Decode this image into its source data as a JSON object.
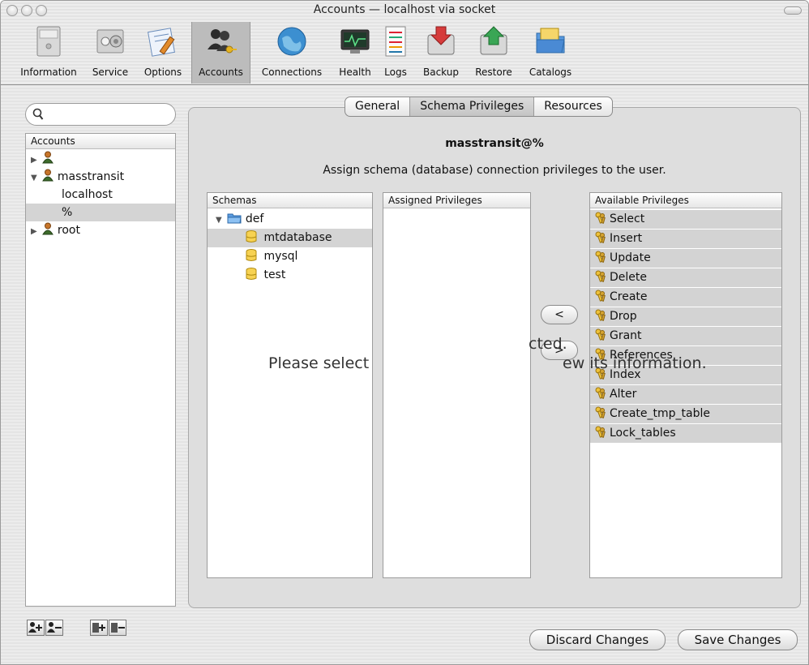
{
  "window": {
    "title": "Accounts — localhost via socket"
  },
  "toolbar": {
    "items": [
      {
        "label": "Information",
        "icon": "server-tower-icon"
      },
      {
        "label": "Service",
        "icon": "control-panel-icon"
      },
      {
        "label": "Options",
        "icon": "options-pen-icon"
      },
      {
        "label": "Accounts",
        "icon": "users-key-icon",
        "active": true
      },
      {
        "label": "Connections",
        "icon": "globe-icon"
      },
      {
        "label": "Health",
        "icon": "monitor-icon"
      },
      {
        "label": "Logs",
        "icon": "list-icon"
      },
      {
        "label": "Backup",
        "icon": "disk-down-arrow-icon"
      },
      {
        "label": "Restore",
        "icon": "disk-up-arrow-icon"
      },
      {
        "label": "Catalogs",
        "icon": "folder-icon"
      }
    ]
  },
  "sidebar": {
    "search_placeholder": "",
    "header": "Accounts",
    "accounts": [
      {
        "label": "",
        "level": 0,
        "expanded": false
      },
      {
        "label": "masstransit",
        "level": 0,
        "expanded": true
      },
      {
        "label": "localhost",
        "level": 1
      },
      {
        "label": "%",
        "level": 1,
        "selected": true
      },
      {
        "label": "root",
        "level": 0,
        "expanded": false
      }
    ]
  },
  "tabs": [
    {
      "label": "General"
    },
    {
      "label": "Schema Privileges",
      "active": true
    },
    {
      "label": "Resources"
    }
  ],
  "main": {
    "user": "masstransit@%",
    "description": "Assign schema (database) connection privileges to the user.",
    "overlay_left": "Please select",
    "overlay_mid": "cted.",
    "overlay_right": "ew its information."
  },
  "schemas": {
    "header": "Schemas",
    "items": [
      {
        "label": "def",
        "type": "folder"
      },
      {
        "label": "mtdatabase",
        "type": "db",
        "selected": true
      },
      {
        "label": "mysql",
        "type": "db"
      },
      {
        "label": "test",
        "type": "db"
      }
    ]
  },
  "assigned": {
    "header": "Assigned Privileges",
    "items": []
  },
  "available": {
    "header": "Available Privileges",
    "items": [
      "Select",
      "Insert",
      "Update",
      "Delete",
      "Create",
      "Drop",
      "Grant",
      "References",
      "Index",
      "Alter",
      "Create_tmp_table",
      "Lock_tables"
    ]
  },
  "buttons": {
    "assign": "<",
    "revoke": ">",
    "discard": "Discard Changes",
    "save": "Save Changes"
  },
  "colors": {
    "selection": "#d4d4d4",
    "panel": "#dedede"
  }
}
